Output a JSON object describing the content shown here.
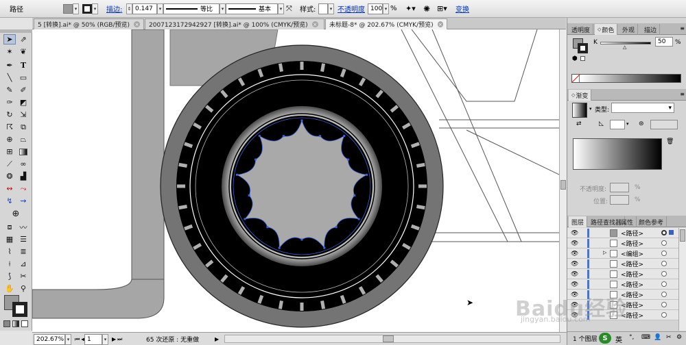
{
  "control": {
    "object_type": "路径",
    "stroke_label": "描边:",
    "stroke_weight": "0.147",
    "profile_label": "等比",
    "brush_label": "基本",
    "style_label": "样式:",
    "opacity_label": "不透明度",
    "opacity_value": "100",
    "percent": "%",
    "transform_label": "变换",
    "fill_color": "#9a9a9a"
  },
  "tabs": [
    {
      "label": "5 [转换].ai* @ 50% (RGB/预览)",
      "close": "×"
    },
    {
      "label": "2007123172942927 [转换].ai* @ 100% (CMYK/预览)",
      "close": "×"
    },
    {
      "label": "未标题-8* @ 202.67% (CMYK/预览)",
      "close": "×"
    }
  ],
  "status": {
    "zoom": "202.67%",
    "artboard": "1",
    "history": "65 次还原 : 无重做"
  },
  "color_panel": {
    "tabs": [
      "透明度",
      "颜色",
      "外观",
      "描边"
    ],
    "channel": "K",
    "value": "50",
    "percent": "%"
  },
  "gradient_panel": {
    "tab": "渐变",
    "type_label": "类型:",
    "opacity_label": "不透明度:",
    "position_label": "位置:",
    "percent": "%"
  },
  "layers_panel": {
    "tabs": [
      "图层",
      "路径查找器",
      "属性",
      "颜色参考"
    ],
    "rows": [
      {
        "label": "<路径>"
      },
      {
        "label": "<路径>"
      },
      {
        "label": "<编组>"
      },
      {
        "label": "<路径>"
      },
      {
        "label": "<路径>"
      },
      {
        "label": "<路径>"
      },
      {
        "label": "<路径>"
      },
      {
        "label": "<路径>"
      },
      {
        "label": "<路径>"
      }
    ],
    "footer": "1 个图层"
  },
  "taskbar": {
    "ime": "英"
  },
  "watermark": {
    "brand": "Baidu经验",
    "url": "jingyan.baidu.com"
  },
  "icons": [
    "selection-tool-icon",
    "direct-selection-icon",
    "magic-wand-icon",
    "lasso-icon",
    "pen-icon",
    "type-icon",
    "line-icon",
    "rectangle-icon",
    "brush-icon",
    "pencil-icon",
    "blob-brush-icon",
    "eraser-icon",
    "rotate-icon",
    "scale-icon",
    "warp-icon",
    "free-transform-icon",
    "shape-builder-icon",
    "perspective-icon",
    "mesh-icon",
    "gradient-icon",
    "eyedropper-icon",
    "blend-icon",
    "symbol-sprayer-icon",
    "graph-icon",
    "artboard-icon",
    "slice-icon",
    "hand-icon",
    "zoom-icon"
  ]
}
